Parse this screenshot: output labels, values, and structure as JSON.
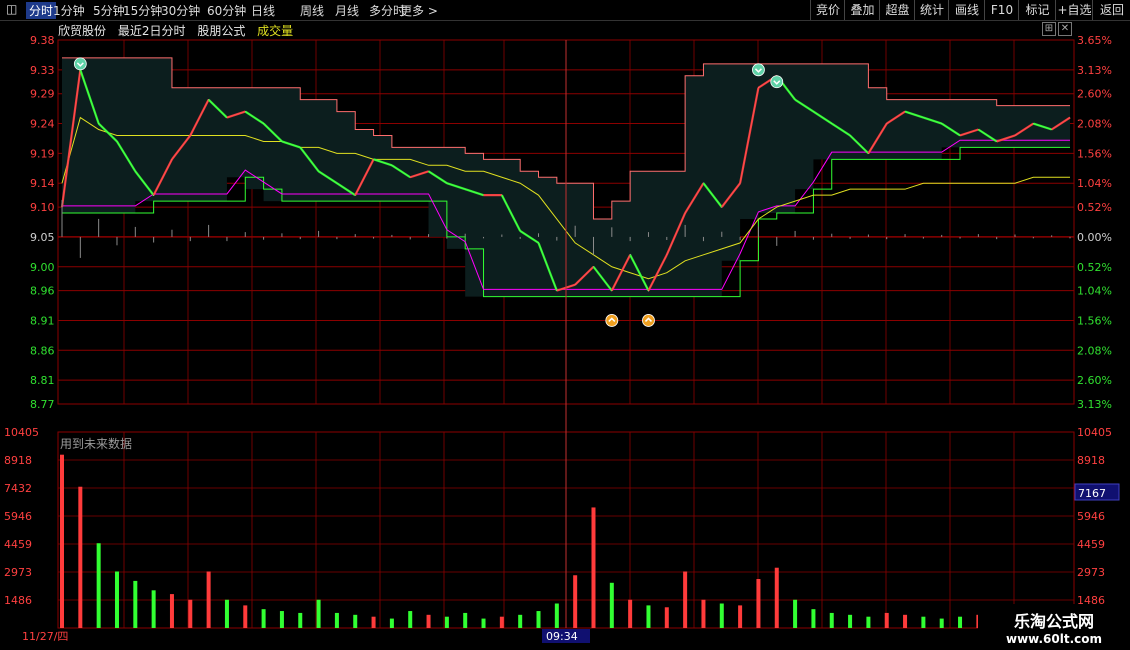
{
  "toolbar": {
    "left_items": [
      "分时",
      "1分钟",
      "5分钟",
      "15分钟",
      "30分钟",
      "60分钟",
      "日线",
      "周线",
      "月线",
      "多分时",
      "更多 >"
    ],
    "active_index": 0,
    "right_items": [
      "竞价",
      "叠加",
      "超盘",
      "统计",
      "画线",
      "F10",
      "标记",
      "+自选",
      "返回"
    ]
  },
  "info": {
    "stock_name": "欣贸股份",
    "period": "最近2日分时",
    "formula": "股朋公式",
    "indicator": "成交量",
    "ctrl_buttons": [
      "⊞",
      "✕"
    ]
  },
  "volume_panel": {
    "note": "用到未来数据"
  },
  "bottom": {
    "date_label": "11/27/四",
    "cursor_time": "09:34"
  },
  "watermark": {
    "title": "乐淘公式网",
    "url": "www.60lt.com"
  },
  "colors": {
    "bg": "#000000",
    "grid": "#8b0000",
    "up": "#ff3b3b",
    "down": "#32ff32",
    "price_line": "#ffffff",
    "avg_line": "#e0e020",
    "magenta": "#ff00ff",
    "band": "#0c1e1e",
    "band_edge": "#ff6e6e",
    "axis_up": "#ff4040",
    "axis_down": "#30e030"
  },
  "chart_data": {
    "type": "line",
    "price_axis": {
      "ticks": [
        9.38,
        9.33,
        9.29,
        9.24,
        9.19,
        9.14,
        9.1,
        9.05,
        9.0,
        8.96,
        8.91,
        8.86,
        8.81,
        8.77
      ],
      "ylim": [
        8.77,
        9.38
      ],
      "prev_close": 9.05
    },
    "percent_axis": {
      "ticks": [
        "3.65%",
        "3.13%",
        "2.60%",
        "2.08%",
        "1.56%",
        "1.04%",
        "0.52%",
        "0.00%",
        "0.52%",
        "1.04%",
        "1.56%",
        "2.08%",
        "2.60%",
        "3.13%"
      ]
    },
    "volume_axis": {
      "ticks": [
        10405,
        8918,
        7432,
        5946,
        4459,
        2973,
        1486
      ],
      "ylim": [
        0,
        10405
      ],
      "marker": "7167"
    },
    "series": [
      {
        "values": [
          9.1,
          9.33,
          9.24,
          9.21,
          9.16,
          9.12,
          9.18,
          9.22,
          9.28,
          9.25,
          9.26,
          9.24,
          9.21,
          9.2,
          9.16,
          9.14,
          9.12,
          9.18,
          9.17,
          9.15,
          9.16,
          9.14,
          9.13,
          9.12,
          9.12,
          9.06,
          9.04,
          8.96,
          8.97,
          9.0,
          8.96,
          9.02,
          8.96,
          9.02,
          9.09,
          9.14,
          9.1,
          9.14,
          9.3,
          9.32,
          9.28,
          9.26,
          9.24,
          9.22,
          9.19,
          9.24,
          9.26,
          9.25,
          9.24,
          9.22,
          9.23,
          9.21,
          9.22,
          9.24,
          9.23,
          9.25
        ]
      },
      {
        "values": [
          9.14,
          9.25,
          9.23,
          9.22,
          9.22,
          9.22,
          9.22,
          9.22,
          9.22,
          9.22,
          9.22,
          9.21,
          9.21,
          9.2,
          9.2,
          9.19,
          9.19,
          9.18,
          9.18,
          9.18,
          9.17,
          9.17,
          9.16,
          9.16,
          9.15,
          9.14,
          9.12,
          9.08,
          9.04,
          9.02,
          9.0,
          8.99,
          8.98,
          8.99,
          9.01,
          9.02,
          9.03,
          9.04,
          9.08,
          9.1,
          9.11,
          9.12,
          9.12,
          9.13,
          9.13,
          9.13,
          9.13,
          9.14,
          9.14,
          9.14,
          9.14,
          9.14,
          9.14,
          9.15,
          9.15,
          9.15
        ]
      }
    ],
    "signal_markers": [
      {
        "type": "sell",
        "x_index": 1,
        "price": 9.34
      },
      {
        "type": "sell",
        "x_index": 38,
        "price": 9.33
      },
      {
        "type": "sell",
        "x_index": 39,
        "price": 9.31
      },
      {
        "type": "buy",
        "x_index": 30,
        "price": 8.91
      },
      {
        "type": "buy",
        "x_index": 32,
        "price": 8.91
      }
    ],
    "volume": [
      9200,
      7500,
      4500,
      3000,
      2500,
      2000,
      1800,
      1500,
      3000,
      1500,
      1200,
      1000,
      900,
      800,
      1500,
      800,
      700,
      600,
      500,
      900,
      700,
      600,
      800,
      500,
      600,
      700,
      900,
      1300,
      2800,
      6400,
      2400,
      1500,
      1200,
      1100,
      3000,
      1500,
      1300,
      1200,
      2600,
      3200,
      1500,
      1000,
      800,
      700,
      600,
      800,
      700,
      600,
      500,
      600,
      700,
      800,
      600,
      500,
      400,
      500
    ]
  }
}
